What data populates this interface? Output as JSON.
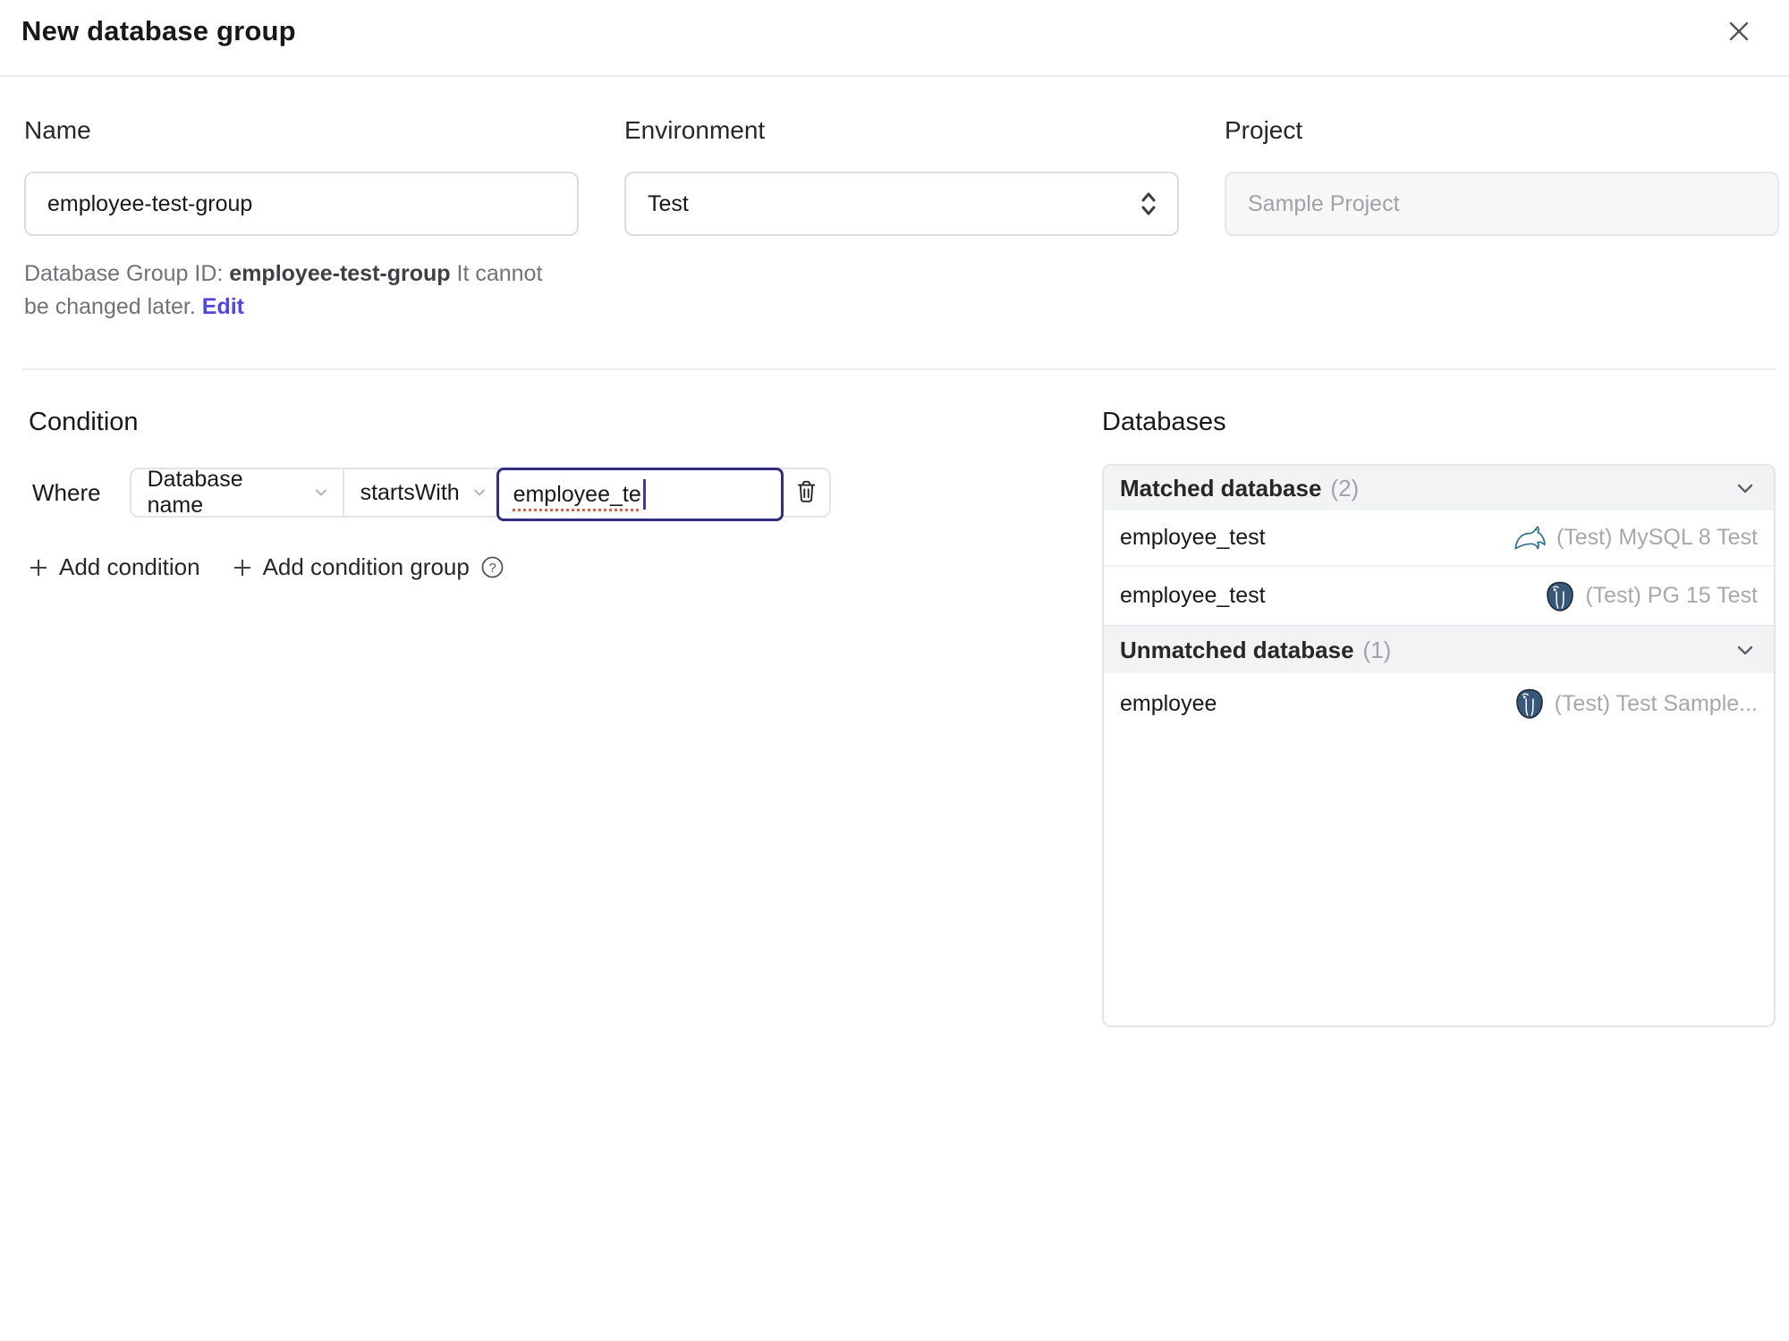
{
  "dialog": {
    "title": "New database group"
  },
  "form": {
    "name": {
      "label": "Name",
      "value": "employee-test-group"
    },
    "environment": {
      "label": "Environment",
      "value": "Test"
    },
    "project": {
      "label": "Project",
      "value": "Sample Project"
    },
    "group_id_note": {
      "prefix": "Database Group ID: ",
      "id": "employee-test-group",
      "suffix": " It cannot be changed later. ",
      "edit_label": "Edit"
    }
  },
  "condition": {
    "heading": "Condition",
    "where_label": "Where",
    "factor": "Database name",
    "operator": "startsWith",
    "value": "employee_te",
    "add_condition_label": "Add condition",
    "add_condition_group_label": "Add condition group"
  },
  "databases": {
    "heading": "Databases",
    "matched": {
      "title": "Matched database",
      "count": "(2)",
      "rows": [
        {
          "name": "employee_test",
          "engine": "mysql",
          "instance": "(Test) MySQL 8 Test"
        },
        {
          "name": "employee_test",
          "engine": "postgres",
          "instance": "(Test) PG 15 Test"
        }
      ]
    },
    "unmatched": {
      "title": "Unmatched database",
      "count": "(1)",
      "rows": [
        {
          "name": "employee",
          "engine": "postgres",
          "instance": "(Test) Test Sample..."
        }
      ]
    }
  },
  "colors": {
    "accent": "#4f46e5",
    "focus_border": "#312e81",
    "muted_text": "#a1a1aa",
    "spellcheck_underline": "#e25c4a",
    "mysql_icon": "#2e6f8e",
    "postgres_icon": "#38587a",
    "header_bar_bg": "#f2f3f5"
  }
}
